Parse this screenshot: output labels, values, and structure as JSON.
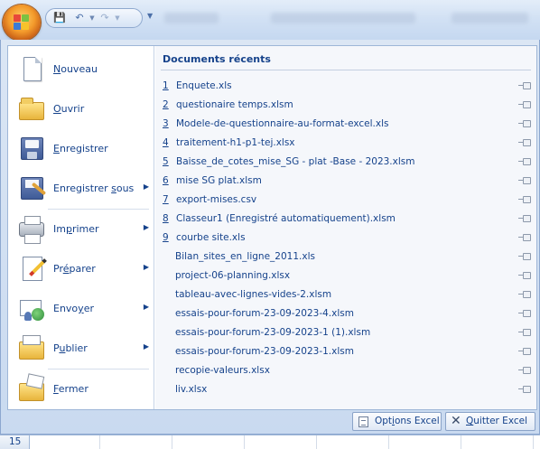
{
  "quick_access": {
    "icons": [
      "save-icon",
      "undo-icon",
      "redo-icon",
      "customize-icon"
    ]
  },
  "left_menu": [
    {
      "pre": "",
      "acc": "N",
      "post": "ouveau",
      "has_submenu": false,
      "icon": "new-document-icon"
    },
    {
      "pre": "",
      "acc": "O",
      "post": "uvrir",
      "has_submenu": false,
      "icon": "open-folder-icon"
    },
    {
      "pre": "",
      "acc": "E",
      "post": "nregistrer",
      "has_submenu": false,
      "icon": "save-disk-icon"
    },
    {
      "pre": "Enregistrer ",
      "acc": "s",
      "post": "ous",
      "has_submenu": true,
      "icon": "save-as-icon"
    },
    {
      "pre": "Im",
      "acc": "p",
      "post": "rimer",
      "has_submenu": true,
      "icon": "printer-icon"
    },
    {
      "pre": "Pr",
      "acc": "é",
      "post": "parer",
      "has_submenu": true,
      "icon": "prepare-icon"
    },
    {
      "pre": "Envo",
      "acc": "y",
      "post": "er",
      "has_submenu": true,
      "icon": "send-icon"
    },
    {
      "pre": "P",
      "acc": "u",
      "post": "blier",
      "has_submenu": true,
      "icon": "publish-icon"
    },
    {
      "pre": "",
      "acc": "F",
      "post": "ermer",
      "has_submenu": false,
      "icon": "close-document-icon"
    }
  ],
  "recent": {
    "title": "Documents récents",
    "items": [
      {
        "num": "1",
        "name": "Enquete.xls"
      },
      {
        "num": "2",
        "name": "questionaire temps.xlsm"
      },
      {
        "num": "3",
        "name": "Modele-de-questionnaire-au-format-excel.xls"
      },
      {
        "num": "4",
        "name": "traitement-h1-p1-tej.xlsx"
      },
      {
        "num": "5",
        "name": "Baisse_de_cotes_mise_SG - plat -Base - 2023.xlsm"
      },
      {
        "num": "6",
        "name": "mise SG plat.xlsm"
      },
      {
        "num": "7",
        "name": "export-mises.csv"
      },
      {
        "num": "8",
        "name": "Classeur1 (Enregistré automatiquement).xlsm"
      },
      {
        "num": "9",
        "name": "courbe site.xls"
      },
      {
        "num": "",
        "name": "Bilan_sites_en_ligne_2011.xls"
      },
      {
        "num": "",
        "name": "project-06-planning.xlsx"
      },
      {
        "num": "",
        "name": "tableau-avec-lignes-vides-2.xlsm"
      },
      {
        "num": "",
        "name": "essais-pour-forum-23-09-2023-4.xlsm"
      },
      {
        "num": "",
        "name": "essais-pour-forum-23-09-2023-1 (1).xlsm"
      },
      {
        "num": "",
        "name": "essais-pour-forum-23-09-2023-1.xlsm"
      },
      {
        "num": "",
        "name": "recopie-valeurs.xlsx"
      },
      {
        "num": "",
        "name": "liv.xlsx"
      }
    ]
  },
  "buttons": {
    "options": {
      "pre": "Opt",
      "acc": "i",
      "post": "ons Excel"
    },
    "quit": {
      "pre": "",
      "acc": "Q",
      "post": "uitter Excel"
    }
  },
  "sheet": {
    "row_number": "15"
  },
  "colors": {
    "text": "#15428b",
    "frame": "#c9daf0",
    "office_button": "#f39a2b"
  }
}
